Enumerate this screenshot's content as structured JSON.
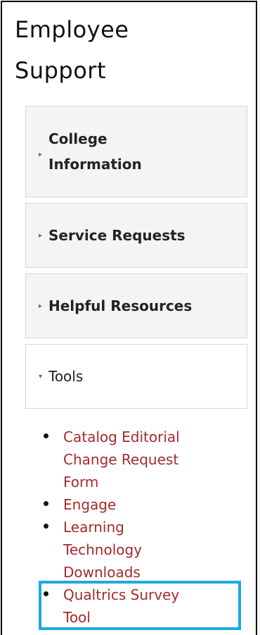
{
  "sidebar": {
    "title_line1": "Employee",
    "title_line2": "Support",
    "items": [
      {
        "label_line1": "College",
        "label_line2": "Information",
        "expanded": false
      },
      {
        "label": "Service Requests",
        "expanded": false
      },
      {
        "label": "Helpful Resources",
        "expanded": false
      },
      {
        "label": "Tools",
        "expanded": true
      }
    ],
    "tool_links": [
      {
        "line1": "Catalog Editorial",
        "line2": "Change Request",
        "line3": "Form"
      },
      {
        "line1": "Engage"
      },
      {
        "line1": "Learning",
        "line2": "Technology",
        "line3": "Downloads"
      },
      {
        "line1": "Qualtrics Survey",
        "line2": "Tool"
      }
    ],
    "icons": {
      "collapsed": "caret-right-icon",
      "expanded": "caret-down-icon"
    }
  },
  "colors": {
    "link": "#a52a2a",
    "highlight": "#1fa8e0",
    "accordion_bg": "#f4f4f4",
    "accordion_border": "#d6d6d6"
  }
}
